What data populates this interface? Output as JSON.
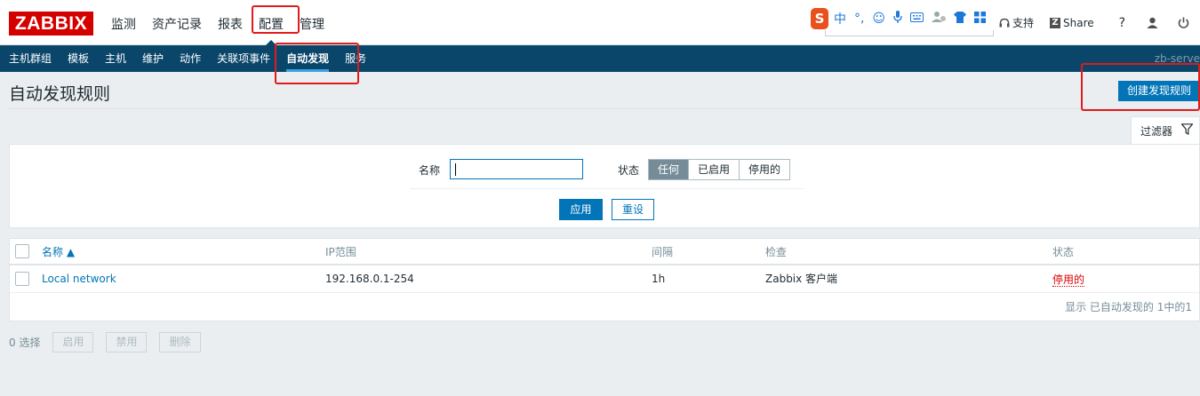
{
  "header": {
    "logo": "ZABBIX",
    "menu": [
      "监测",
      "资产记录",
      "报表",
      "配置",
      "管理"
    ],
    "active_menu": "配置",
    "ime": {
      "badge": "S",
      "lang": "中",
      "punct": "°,"
    },
    "support": "支持",
    "share_badge": "Z",
    "share": "Share",
    "help": "?"
  },
  "subnav": {
    "items": [
      "主机群组",
      "模板",
      "主机",
      "维护",
      "动作",
      "关联项事件",
      "自动发现",
      "服务"
    ],
    "active": "自动发现",
    "server": "zb-serve"
  },
  "page": {
    "title": "自动发现规则",
    "create_button": "创建发现规则"
  },
  "filter": {
    "tab_label": "过滤器",
    "name_label": "名称",
    "name_value": "",
    "status_label": "状态",
    "status_options": [
      "任何",
      "已启用",
      "停用的"
    ],
    "status_selected": "任何",
    "apply": "应用",
    "reset": "重设"
  },
  "table": {
    "columns": [
      "名称 ▲",
      "IP范围",
      "间隔",
      "检查",
      "状态"
    ],
    "rows": [
      {
        "name": "Local network",
        "ip_range": "192.168.0.1-254",
        "interval": "1h",
        "checks": "Zabbix 客户端",
        "status": "停用的"
      }
    ],
    "footer": "显示 已自动发现的 1中的1"
  },
  "actions": {
    "selected": "0 选择",
    "buttons": [
      "启用",
      "禁用",
      "删除"
    ]
  },
  "colors": {
    "brand": "#d40000",
    "nav": "#0a466a",
    "primary": "#0275b8",
    "disabled_status": "#dc0000",
    "annotation": "#e01b1b"
  }
}
